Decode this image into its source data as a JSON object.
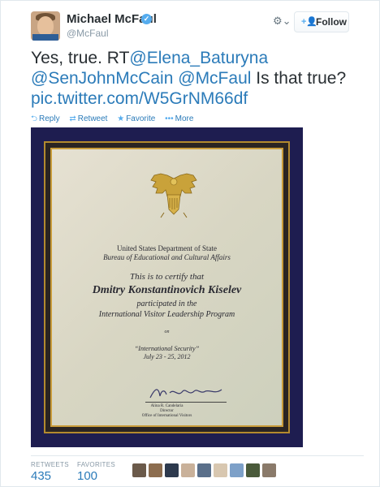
{
  "user": {
    "name": "Michael McFaul",
    "handle": "@McFaul",
    "verified_glyph": "✓"
  },
  "header": {
    "gear_label": "⚙⌄",
    "follow_label": "Follow",
    "follow_icon": "+👤"
  },
  "tweet": {
    "part1": "Yes, true. RT",
    "mention1": "@Elena_Baturyna",
    "mention2": "@SenJohnMcCain",
    "mention3": "@McFaul",
    "part2": " Is that true?",
    "link": "pic.twitter.com/W5GrNM66df"
  },
  "actions": {
    "reply": "Reply",
    "retweet": "Retweet",
    "favorite": "Favorite",
    "more": "More",
    "reply_icon": "⮌",
    "retweet_icon": "⇄",
    "favorite_icon": "★",
    "more_icon": "•••"
  },
  "certificate": {
    "line1": "United States Department of State",
    "line2": "Bureau of Educational and Cultural Affairs",
    "line3": "This is to certify that",
    "recipient": "Dmitry  Konstantinovich Kiselev",
    "line5": "participated in the",
    "line6": "International Visitor Leadership Program",
    "line7": "on",
    "topic": "“International Security”",
    "dates": "July 23 - 25, 2012",
    "signer": "Alina R. Candelaria",
    "signer_title": "Director",
    "signer_office": "Office of International Visitors"
  },
  "stats": {
    "retweets_label": "RETWEETS",
    "retweets_value": "435",
    "favorites_label": "FAVORITES",
    "favorites_value": "100"
  },
  "colors": {
    "link": "#2b7bb9",
    "accent": "#55acee",
    "text": "#292f33",
    "muted": "#8899a6",
    "photo_bg": "#1e1d50",
    "frame_gold": "#c99c3a"
  }
}
